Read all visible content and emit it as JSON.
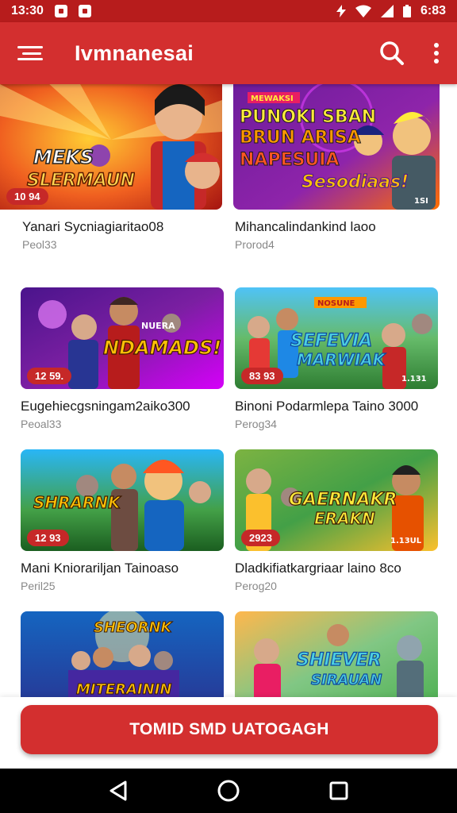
{
  "status_bar": {
    "time": "13:30",
    "right_text": "6:83",
    "icons": [
      "notification-icon",
      "notification-icon",
      "bolt-icon",
      "wifi-icon",
      "signal-icon",
      "battery-icon"
    ]
  },
  "app_bar": {
    "title": "Ivmnanesai",
    "icons": [
      "menu-icon",
      "search-icon",
      "more-vert-icon"
    ]
  },
  "cards": [
    {
      "title": "Yanari Sycniagiaritao08",
      "subtitle": "Peol33",
      "badge": "10 94",
      "thumb_text": [
        "MEKS",
        "SLERMAUN"
      ]
    },
    {
      "title": "Mihancalindankind laoo",
      "subtitle": "Prorod4",
      "badge": "",
      "thumb_text": [
        "MEWAKSI",
        "PUNOKI SBAN",
        "BRUN ARISA",
        "NAPESUIA",
        "Sesodiaas!",
        "1SI"
      ]
    },
    {
      "title": "Eugehiecgsningam2aiko300",
      "subtitle": "Peoal33",
      "badge": "12 59.",
      "thumb_text": [
        "NUERA",
        "NDAMADS!"
      ]
    },
    {
      "title": "Binoni Podarmlepa Taino 3000",
      "subtitle": "Perog34",
      "badge": "83 93",
      "thumb_text": [
        "NOSUNE",
        "SEFEVIA",
        "MARWIAK",
        "1.131"
      ]
    },
    {
      "title": "Mani Kniorariljan Tainoaso",
      "subtitle": "Peril25",
      "badge": "12 93",
      "thumb_text": [
        "SHRARNK"
      ]
    },
    {
      "title": "Dladkifiatkargriaar laino 8co",
      "subtitle": "Perog20",
      "badge": "2923",
      "thumb_text": [
        "GAERNAKR",
        "ERAKN",
        "1.13UL"
      ]
    },
    {
      "title": "",
      "subtitle": "",
      "badge": "",
      "thumb_text": [
        "SHEORNK",
        "MITERAININ"
      ]
    },
    {
      "title": "",
      "subtitle": "",
      "badge": "",
      "thumb_text": [
        "SHIEVER",
        "SIRAUAN"
      ]
    }
  ],
  "cta": {
    "label": "TOMID SMD UATOGAGH"
  },
  "nav": {
    "icons": [
      "back-icon",
      "home-icon",
      "recents-icon"
    ]
  },
  "colors": {
    "accent": "#d32f2f",
    "status": "#b71c1c",
    "badge": "#c62828"
  }
}
